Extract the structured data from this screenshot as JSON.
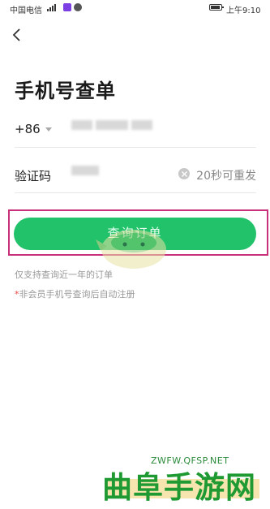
{
  "status_bar": {
    "carrier": "中国电信",
    "network": "4G",
    "time": "上午9:10"
  },
  "header": {
    "back_icon": "chevron-left-icon",
    "title": "手机号查单"
  },
  "phone_row": {
    "country_code": "+86",
    "caret_icon": "caret-down-icon"
  },
  "code_row": {
    "label": "验证码",
    "clear_icon": "clear-circle-icon",
    "resend_label": "20秒可重发"
  },
  "submit": {
    "label": "查询订单"
  },
  "hints": {
    "range_note": "仅支持查询近一年的订单",
    "notice_mark": "*",
    "notice_text": "非会员手机号查询后自动注册"
  },
  "watermark": {
    "main": "曲阜手游网",
    "sub": "ZWFW.QFSP.NET"
  },
  "colors": {
    "accent": "#21c26a",
    "highlight": "#c8317a",
    "asterisk": "#e84545",
    "watermark": "#1f9a33"
  }
}
